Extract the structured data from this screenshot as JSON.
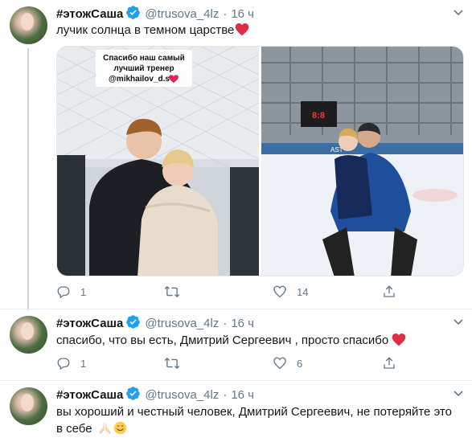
{
  "tweets": [
    {
      "name": "#этожСаша",
      "handle": "@trusova_4lz",
      "dot": "·",
      "time": "16 ч",
      "text": "лучик солнца в темном царстве",
      "photo_caption": [
        "Спасибо наш самый",
        "лучший тренер",
        "@mikhailov_d.s"
      ],
      "scoreboard": "8:8",
      "rink_banner": "AST",
      "replies": "1",
      "retweets": "",
      "likes": "14"
    },
    {
      "name": "#этожСаша",
      "handle": "@trusova_4lz",
      "dot": "·",
      "time": "16 ч",
      "text": "спасибо, что вы есть, Дмитрий Сергеевич , просто спасибо",
      "replies": "1",
      "retweets": "",
      "likes": "6"
    },
    {
      "name": "#этожСаша",
      "handle": "@trusova_4lz",
      "dot": "·",
      "time": "16 ч",
      "text_line1": "вы хороший  и честный человек, Дмитрий Сергеевич, не потеряйте это",
      "text_line2": "в себе"
    }
  ],
  "colors": {
    "verified": "#1da1f2",
    "heart": "#e0245e",
    "meta": "#657786",
    "divider": "#e6ecf0"
  },
  "icons": {
    "reply": "reply-icon",
    "retweet": "retweet-icon",
    "like": "heart-icon",
    "share": "share-icon",
    "caret": "chevron-down-icon",
    "verified": "verified-badge-icon"
  }
}
